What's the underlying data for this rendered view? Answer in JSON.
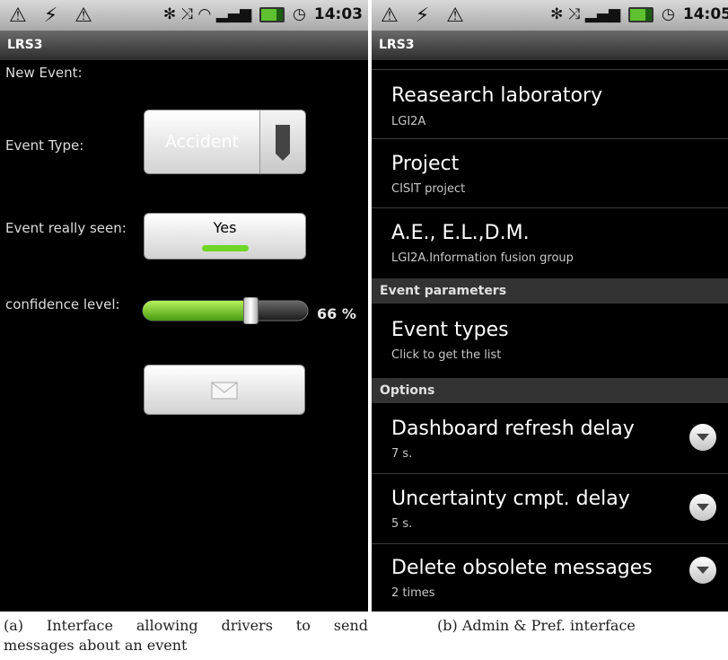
{
  "screen_a": {
    "statusbar": {
      "left_icons": "⚠ ⚡ ⚠",
      "right_icons": "✻ ⤨ ◠ ▂▄▆",
      "time": "14:03"
    },
    "app_title": "LRS3",
    "new_event_label": "New Event:",
    "event_type_label": "Event Type:",
    "event_type_value": "Accident",
    "event_seen_label": "Event really seen:",
    "event_seen_value": "Yes",
    "confidence_label": "confidence level:",
    "confidence_value": 0.66,
    "confidence_text": "66 %"
  },
  "screen_b": {
    "statusbar": {
      "left_icons": "⚠ ⚡ ⚠",
      "right_icons": "✻ ⤨ ▂▄▆",
      "time": "14:05"
    },
    "app_title": "LRS3",
    "items": [
      {
        "title": "Reasearch laboratory",
        "subtitle": "LGI2A"
      },
      {
        "title": "Project",
        "subtitle": "CISIT project"
      },
      {
        "title": "A.E., E.L.,D.M.",
        "subtitle": "LGI2A.Information fusion group"
      }
    ],
    "section_event": "Event parameters",
    "event_types": {
      "title": "Event types",
      "subtitle": "Click to get the list"
    },
    "section_options": "Options",
    "options": [
      {
        "title": "Dashboard refresh delay",
        "subtitle": "7 s."
      },
      {
        "title": "Uncertainty cmpt. delay",
        "subtitle": "5 s."
      },
      {
        "title": "Delete obsolete messages",
        "subtitle": "2 times"
      }
    ]
  },
  "captions": {
    "a_line1": "(a) Interface allowing drivers to send",
    "a_line2": "messages about an event",
    "b": "(b) Admin & Pref. interface"
  }
}
